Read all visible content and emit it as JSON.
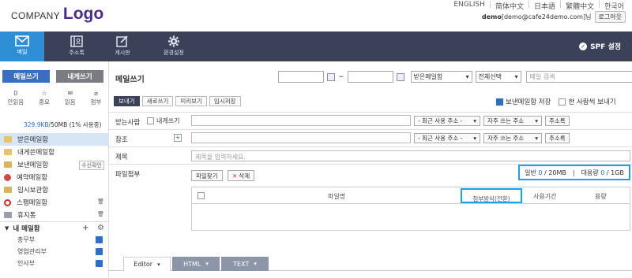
{
  "header": {
    "company": "COMPANY",
    "logo": "Logo",
    "languages": [
      "ENGLISH",
      "简体中文",
      "日本語",
      "繁體中文",
      "한국어"
    ],
    "user_id": "demo",
    "user_email": "[demo@cafe24demo.com]님",
    "logout_label": "로그아웃"
  },
  "nav": {
    "items": [
      {
        "label": "메일",
        "icon": "mail-icon"
      },
      {
        "label": "주소록",
        "icon": "contacts-icon"
      },
      {
        "label": "게시판",
        "icon": "board-icon"
      },
      {
        "label": "환경설정",
        "icon": "gear-icon"
      }
    ],
    "spf_label": "SPF 설정"
  },
  "sidebar": {
    "write_label": "메일쓰기",
    "self_label": "내게쓰기",
    "quick": [
      {
        "num": "0",
        "label": "안읽음"
      },
      {
        "num": "",
        "label": "중요"
      },
      {
        "num": "",
        "label": "읽음"
      },
      {
        "num": "",
        "label": "첨부"
      }
    ],
    "usage_used": "329.9KB",
    "usage_rest": "/50MB (1% 사용중)",
    "folders": [
      {
        "label": "받은메일함",
        "color": "#e8c36a"
      },
      {
        "label": "내게쓴메일함",
        "color": "#e8c36a"
      },
      {
        "label": "보낸메일함",
        "color": "#d9b45c",
        "right": "수신확인"
      },
      {
        "label": "예약메일함",
        "color": "#d04a4a"
      },
      {
        "label": "임시보관함",
        "color": "#d9b45c"
      },
      {
        "label": "스팸메일함",
        "color": "#cc2b2b"
      },
      {
        "label": "휴지통",
        "color": "#9aa0a8"
      }
    ],
    "mybox_label": "내 메일함",
    "subfolders": [
      "총무부",
      "영업관리부",
      "인사부"
    ]
  },
  "main": {
    "title": "메일쓰기",
    "mailbox_select": "받은메일함",
    "scope_select": "전체선택",
    "search_placeholder": "메일 검색",
    "date_sep": "~",
    "toolbar": [
      "보내기",
      "새로쓰기",
      "미리보기",
      "임시저장"
    ],
    "save_sent_label": "보낸메일함 저장",
    "separate_label": "한 사람씩 보내기",
    "to_label": "받는사람",
    "to_self_label": "내게쓰기",
    "cc_label": "참조",
    "subject_label": "제목",
    "subject_placeholder": "제목을 입력하세요.",
    "attach_label": "파일첨부",
    "recent_addr": "- 최근 사용 주소 -",
    "frequent_addr": "자주 쓰는 주소",
    "addressbook": "주소록",
    "find_file": "파일찾기",
    "delete": "삭제",
    "limit_normal_label": "일반",
    "limit_normal_used": "0",
    "limit_normal_max": "/ 20MB",
    "limit_large_label": "대용량",
    "limit_large_used": "0",
    "limit_large_max": "/ 1GB",
    "limit_sep": "|",
    "cols": {
      "name": "파일명",
      "method": "첨부방식(전환)",
      "period": "사용기간",
      "size": "용량"
    },
    "editor_tabs": [
      "Editor",
      "HTML",
      "TEXT"
    ]
  }
}
